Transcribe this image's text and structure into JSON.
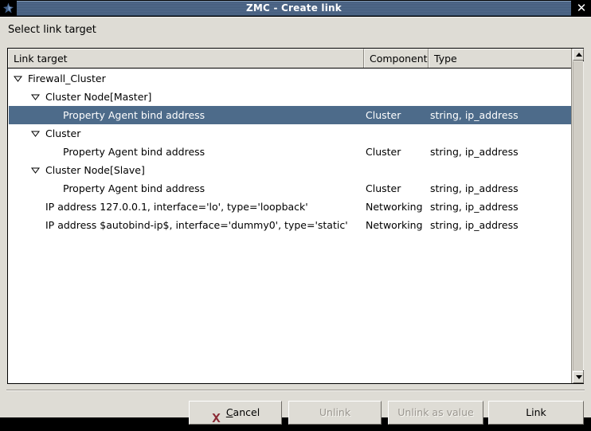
{
  "window": {
    "title": "ZMC - Create link",
    "icon": "app-star-icon",
    "close_label": "✕"
  },
  "dialog": {
    "heading": "Select link target"
  },
  "colors": {
    "titlebar": "#4c6484",
    "selection": "#4d6b8a",
    "face": "#dedcd5",
    "list_background": "#ffffff",
    "cancel_icon": "#8b2b35",
    "disabled_text": "#9a968f"
  },
  "list": {
    "columns": [
      {
        "label": "Link target"
      },
      {
        "label": "Component"
      },
      {
        "label": "Type"
      }
    ],
    "rows": [
      {
        "label": "Firewall_Cluster",
        "component": "",
        "type": "",
        "indent": 0,
        "expandable": true,
        "expanded": true,
        "selected": false
      },
      {
        "label": "Cluster Node[Master]",
        "component": "",
        "type": "",
        "indent": 1,
        "expandable": true,
        "expanded": true,
        "selected": false
      },
      {
        "label": "Property Agent bind address",
        "component": "Cluster",
        "type": "string, ip_address",
        "indent": 2,
        "expandable": false,
        "expanded": false,
        "selected": true
      },
      {
        "label": "Cluster",
        "component": "",
        "type": "",
        "indent": 1,
        "expandable": true,
        "expanded": true,
        "selected": false
      },
      {
        "label": "Property Agent bind address",
        "component": "Cluster",
        "type": "string, ip_address",
        "indent": 2,
        "expandable": false,
        "expanded": false,
        "selected": false
      },
      {
        "label": "Cluster Node[Slave]",
        "component": "",
        "type": "",
        "indent": 1,
        "expandable": true,
        "expanded": true,
        "selected": false
      },
      {
        "label": "Property Agent bind address",
        "component": "Cluster",
        "type": "string, ip_address",
        "indent": 2,
        "expandable": false,
        "expanded": false,
        "selected": false
      },
      {
        "label": "IP address 127.0.0.1, interface='lo', type='loopback'",
        "component": "Networking",
        "type": "string, ip_address",
        "indent": 1,
        "expandable": false,
        "expanded": false,
        "selected": false
      },
      {
        "label": "IP address $autobind-ip$, interface='dummy0', type='static'",
        "component": "Networking",
        "type": "string, ip_address",
        "indent": 1,
        "expandable": false,
        "expanded": false,
        "selected": false
      }
    ]
  },
  "scrollbar": {
    "up_arrow": "scroll-up-icon",
    "down_arrow": "scroll-down-icon"
  },
  "buttons": {
    "cancel": {
      "label": "Cancel",
      "accel": "C",
      "icon": "cancel-x-icon",
      "enabled": true
    },
    "unlink": {
      "label": "Unlink",
      "enabled": false
    },
    "unlink_as_value": {
      "label": "Unlink as value",
      "enabled": false
    },
    "link": {
      "label": "Link",
      "enabled": true
    }
  }
}
